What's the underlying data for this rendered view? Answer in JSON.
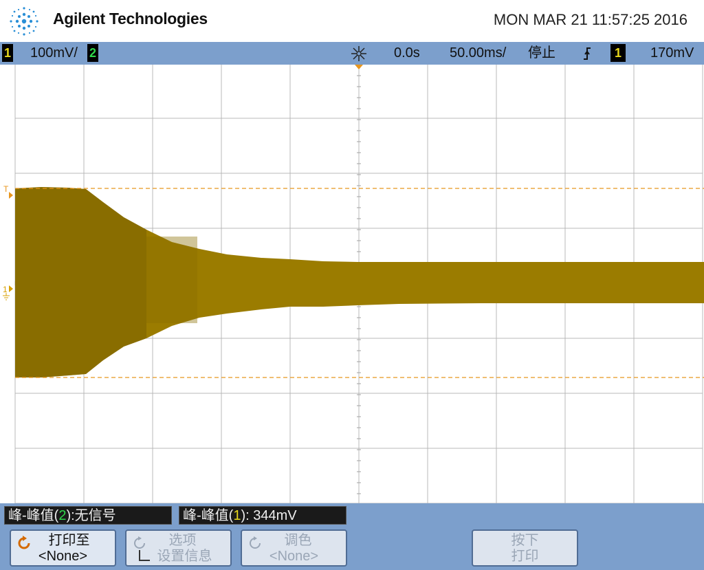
{
  "header": {
    "brand": "Agilent Technologies",
    "datetime": "MON MAR 21 11:57:25 2016",
    "logo_icon": "agilent-spark-icon"
  },
  "statusbar": {
    "ch1_label": "1",
    "ch1_scale": "100mV/",
    "ch2_label": "2",
    "trigger_icon": "trigger-position-icon",
    "time_delay": "0.0s",
    "time_scale": "50.00ms/",
    "run_state": "停止",
    "trigger_edge_icon": "rising-edge-icon",
    "trigger_source": "1",
    "trigger_level": "170mV",
    "colors": {
      "bar": "#7c9fcc",
      "ch1": "#e8d81c",
      "ch2": "#2fd84a"
    }
  },
  "display": {
    "trigger_marker": "T",
    "ch1_ground_marker": "1",
    "waveform_color": "#9b7c00",
    "waveform_dark_color": "#7a6000",
    "cursor_color": "#e8961e",
    "grid_color": "#b8b8b8"
  },
  "measurements": [
    {
      "prefix": "峰-峰值(",
      "channel": "2",
      "suffix": "):无信号"
    },
    {
      "prefix": "峰-峰值(",
      "channel": "1",
      "suffix": "): 344mV"
    }
  ],
  "softkeys": [
    {
      "line1": "打印至",
      "line2": "<None>",
      "icon": "rotate-knob-icon",
      "enabled": true
    },
    {
      "line1": "选项",
      "line2": "设置信息",
      "icon": "rotate-knob-icon",
      "checkbox_icon": "checkbox-icon",
      "enabled": false
    },
    {
      "line1": "调色",
      "line2": "<None>",
      "icon": "rotate-knob-icon",
      "enabled": false
    },
    {
      "line1": "按下",
      "line2": "打印",
      "enabled": false
    }
  ]
}
